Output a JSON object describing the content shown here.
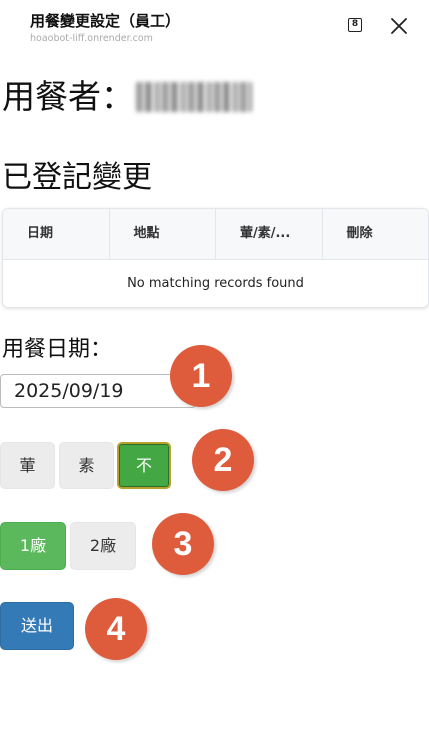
{
  "header": {
    "title": "用餐變更設定（員工）",
    "url": "hoaobot-liff.onrender.com",
    "tab_count": "8"
  },
  "diner": {
    "label": "用餐者："
  },
  "registered": {
    "title": "已登記變更",
    "columns": [
      "日期",
      "地點",
      "葷/素/...",
      "刪除"
    ],
    "empty_message": "No matching records found"
  },
  "form": {
    "date_label": "用餐日期：",
    "date_value": "2025/09/19",
    "meal_options": [
      "葷",
      "素",
      "不"
    ],
    "meal_selected": "不",
    "factory_options": [
      "1廠",
      "2廠"
    ],
    "factory_selected": "1廠",
    "submit_label": "送出"
  },
  "badges": [
    "1",
    "2",
    "3",
    "4"
  ],
  "colors": {
    "badge": "#de5b3c",
    "selected_green": "#43a843",
    "factory_green": "#5cb85c",
    "submit_blue": "#337ab7"
  },
  "icons": {
    "tabs": "tab-count-icon",
    "close": "close-icon"
  }
}
